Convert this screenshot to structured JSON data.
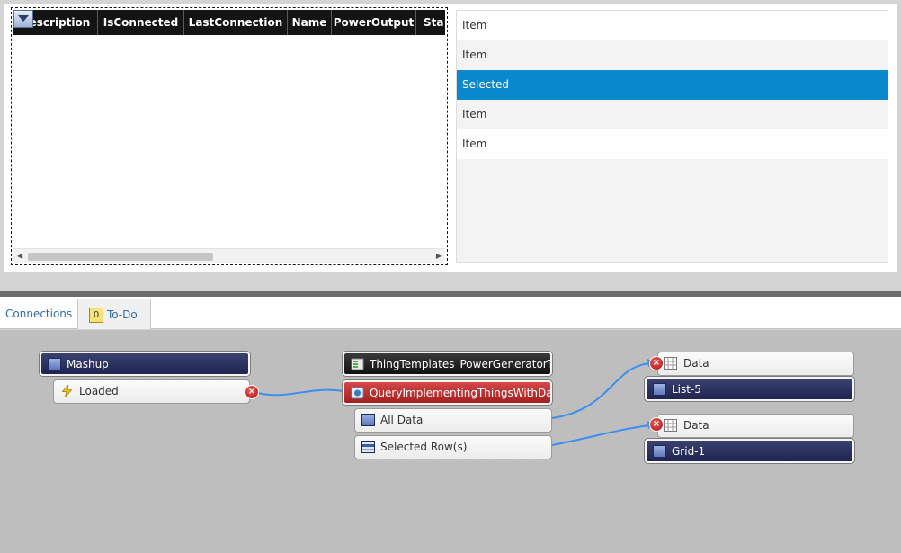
{
  "grid": {
    "columns": [
      "Description",
      "IsConnected",
      "LastConnection",
      "Name",
      "PowerOutput",
      "Sta"
    ]
  },
  "list": {
    "items": [
      {
        "label": "Item",
        "selected": false
      },
      {
        "label": "Item",
        "selected": false
      },
      {
        "label": "Selected",
        "selected": true
      },
      {
        "label": "Item",
        "selected": false
      },
      {
        "label": "Item",
        "selected": false
      }
    ]
  },
  "tabs": {
    "connections": "Connections",
    "todo": "To-Do",
    "todo_count": "0"
  },
  "nodes": {
    "mashup": "Mashup",
    "loaded": "Loaded",
    "thing_template": "ThingTemplates_PowerGeneratorTe...",
    "query": "QueryImplementingThingsWithData",
    "all_data": "All Data",
    "selected_rows": "Selected Row(s)",
    "data_list": "Data",
    "list5": "List-5",
    "data_grid": "Data",
    "grid1": "Grid-1"
  },
  "colors": {
    "selection": "#0a88cc",
    "wire": "#3d8ef0",
    "service_node": "#b52a2a",
    "widget_node": "#262b58"
  }
}
